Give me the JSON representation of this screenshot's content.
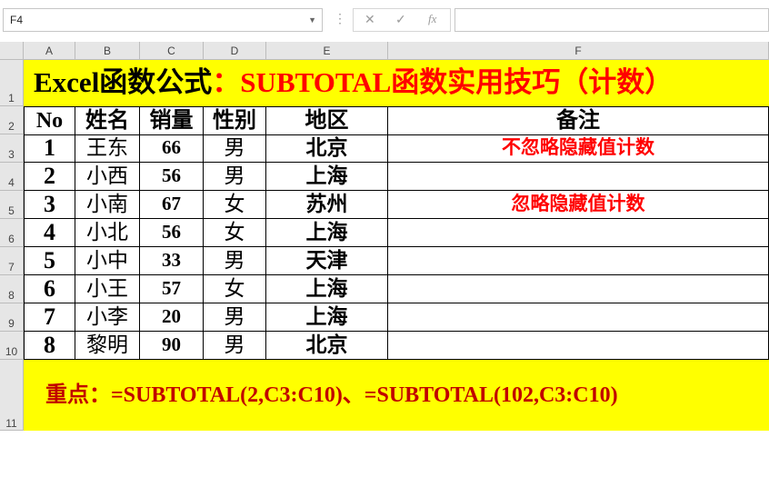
{
  "formula_bar": {
    "name_box": "F4",
    "cancel_icon": "✕",
    "enter_icon": "✓",
    "fx_label": "fx",
    "formula": ""
  },
  "columns": [
    "A",
    "B",
    "C",
    "D",
    "E",
    "F"
  ],
  "rows": [
    "1",
    "2",
    "3",
    "4",
    "5",
    "6",
    "7",
    "8",
    "9",
    "10",
    "11"
  ],
  "title": {
    "black_part": "Excel函数公式",
    "red_part": "：SUBTOTAL函数实用技巧（计数）"
  },
  "headers": [
    "No",
    "姓名",
    "销量",
    "性别",
    "地区",
    "备注"
  ],
  "records": [
    {
      "no": "1",
      "name": "王东",
      "sales": "66",
      "gender": "男",
      "region": "北京"
    },
    {
      "no": "2",
      "name": "小西",
      "sales": "56",
      "gender": "男",
      "region": "上海"
    },
    {
      "no": "3",
      "name": "小南",
      "sales": "67",
      "gender": "女",
      "region": "苏州"
    },
    {
      "no": "4",
      "name": "小北",
      "sales": "56",
      "gender": "女",
      "region": "上海"
    },
    {
      "no": "5",
      "name": "小中",
      "sales": "33",
      "gender": "男",
      "region": "天津"
    },
    {
      "no": "6",
      "name": "小王",
      "sales": "57",
      "gender": "女",
      "region": "上海"
    },
    {
      "no": "7",
      "name": "小李",
      "sales": "20",
      "gender": "男",
      "region": "上海"
    },
    {
      "no": "8",
      "name": "黎明",
      "sales": "90",
      "gender": "男",
      "region": "北京"
    }
  ],
  "notes": {
    "row3": "不忽略隐藏值计数",
    "row5": "忽略隐藏值计数"
  },
  "footer": "重点：=SUBTOTAL(2,C3:C10)、=SUBTOTAL(102,C3:C10)"
}
